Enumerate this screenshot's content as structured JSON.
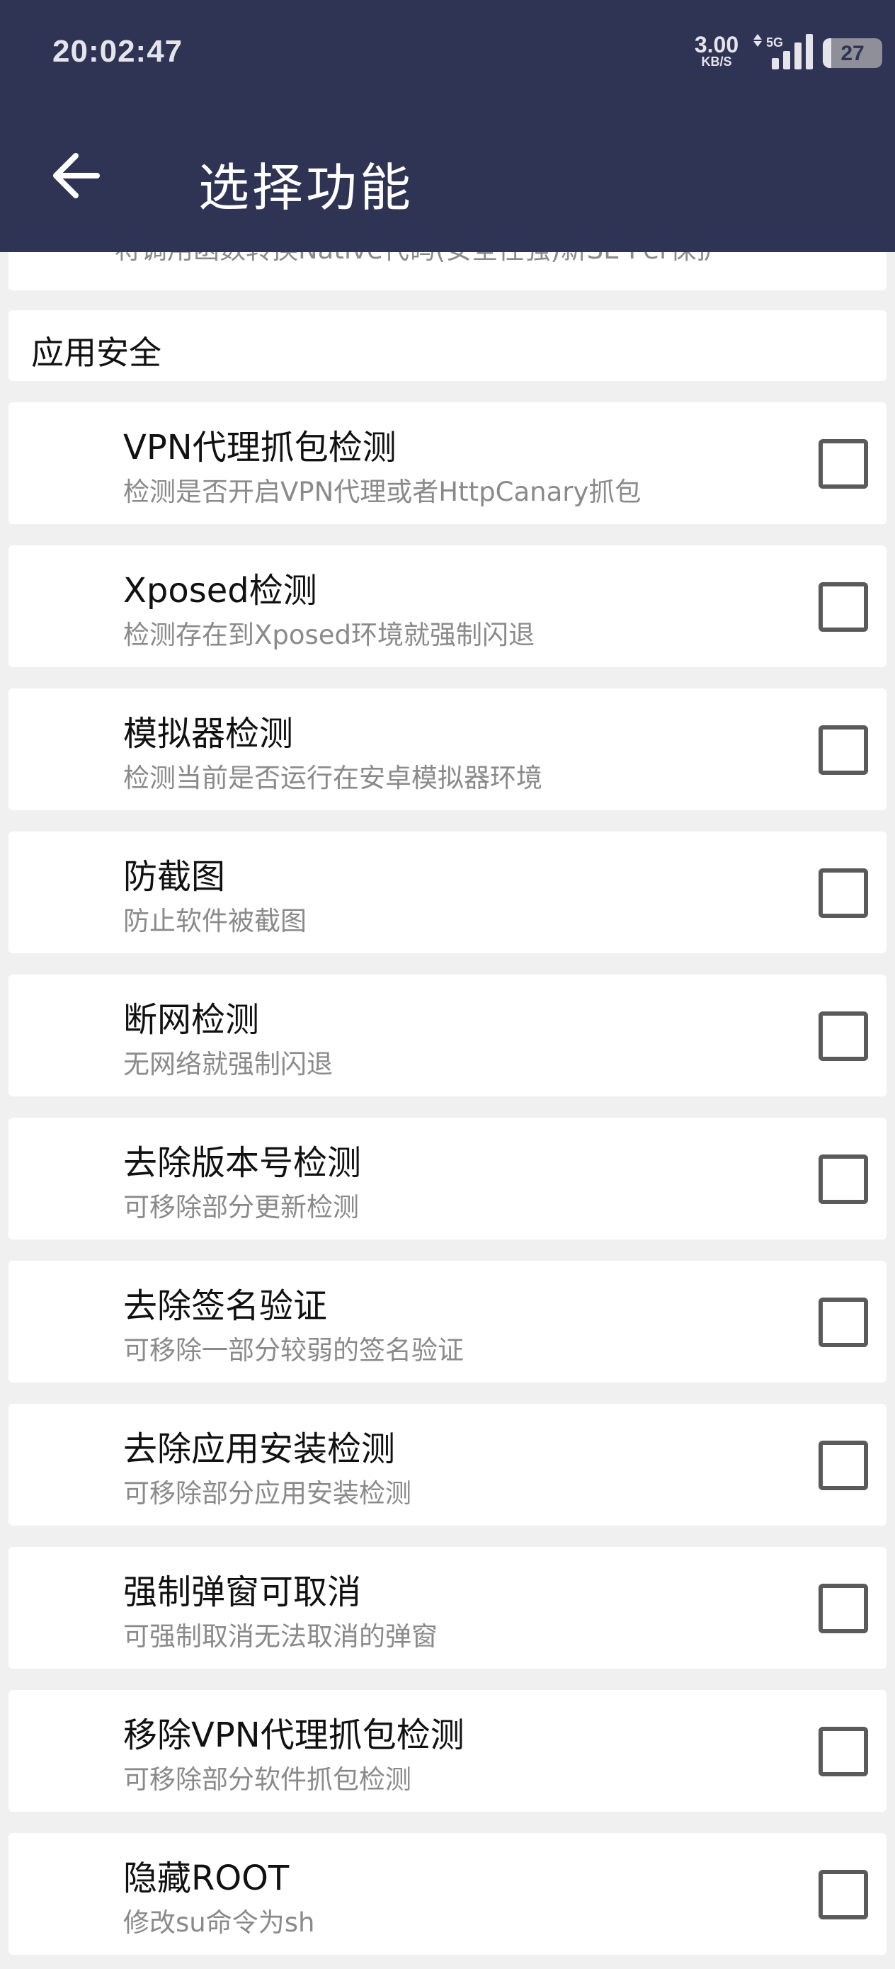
{
  "status_bar": {
    "time": "20:02:47",
    "net_speed_value": "3.00",
    "net_speed_unit": "KB/S",
    "network_type": "5G",
    "battery_level": "27"
  },
  "appbar": {
    "title": "选择功能",
    "back_icon": "arrow-left-icon"
  },
  "previous_item": {
    "subtitle_partial": "将调用函数转换Native代码(安全性强)新SE Per保护"
  },
  "section": {
    "title": "应用安全"
  },
  "items": [
    {
      "title": "VPN代理抓包检测",
      "subtitle": "检测是否开启VPN代理或者HttpCanary抓包",
      "checked": false
    },
    {
      "title": "Xposed检测",
      "subtitle": "检测存在到Xposed环境就强制闪退",
      "checked": false
    },
    {
      "title": "模拟器检测",
      "subtitle": "检测当前是否运行在安卓模拟器环境",
      "checked": false
    },
    {
      "title": "防截图",
      "subtitle": "防止软件被截图",
      "checked": false
    },
    {
      "title": "断网检测",
      "subtitle": "无网络就强制闪退",
      "checked": false
    },
    {
      "title": "去除版本号检测",
      "subtitle": "可移除部分更新检测",
      "checked": false
    },
    {
      "title": "去除签名验证",
      "subtitle": "可移除一部分较弱的签名验证",
      "checked": false
    },
    {
      "title": "去除应用安装检测",
      "subtitle": "可移除部分应用安装检测",
      "checked": false
    },
    {
      "title": "强制弹窗可取消",
      "subtitle": "可强制取消无法取消的弹窗",
      "checked": false
    },
    {
      "title": "移除VPN代理抓包检测",
      "subtitle": "可移除部分软件抓包检测",
      "checked": false
    },
    {
      "title": "隐藏ROOT",
      "subtitle": "修改su命令为sh",
      "checked": false
    }
  ],
  "colors": {
    "appbar": "#2f3354",
    "background": "#f0f0f0",
    "card": "#ffffff",
    "checkbox_border": "#5a5a5a"
  }
}
